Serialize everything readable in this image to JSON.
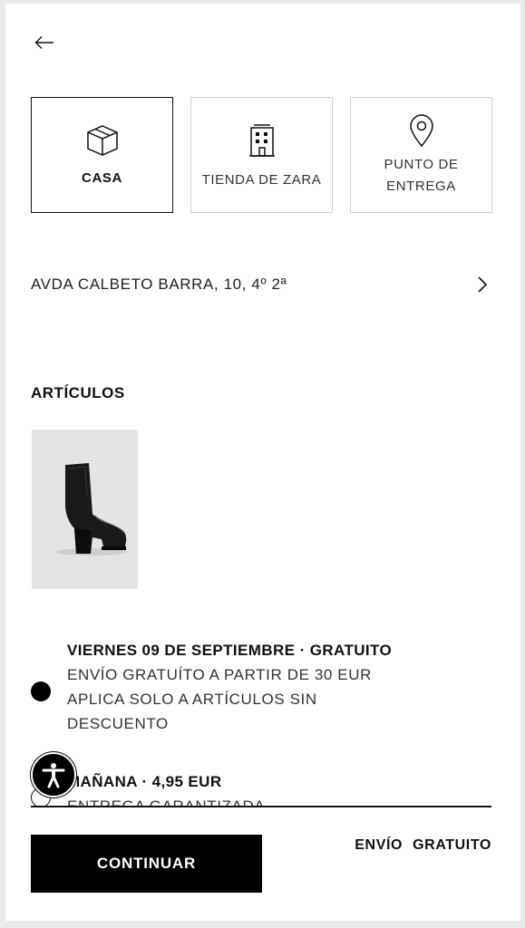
{
  "delivery_methods": [
    {
      "label": "CASA",
      "icon": "box-icon",
      "selected": true
    },
    {
      "label": "TIENDA DE ZARA",
      "icon": "store-building-icon",
      "selected": false
    },
    {
      "label_line1": "PUNTO DE",
      "label_line2": "ENTREGA",
      "icon": "map-pin-icon",
      "selected": false
    }
  ],
  "address": {
    "text": "AVDA CALBETO BARRA, 10, 4º 2ª"
  },
  "items": {
    "title": "ARTÍCULOS",
    "products": [
      {
        "name": "black-heeled-ankle-boot"
      }
    ]
  },
  "shipping_options": [
    {
      "title": "VIERNES 09 DE SEPTIEMBRE · GRATUITO",
      "desc_line1": "ENVÍO GRATUÍTO A PARTIR DE 30 EUR",
      "desc_line2": "APLICA SOLO A ARTÍCULOS SIN",
      "desc_line3": "DESCUENTO",
      "selected": true
    },
    {
      "title": "MAÑANA · 4,95 EUR",
      "desc_line1": "ENTREGA GARANTIZADA",
      "selected": false
    }
  ],
  "footer": {
    "continue_label": "CONTINUAR",
    "shipping_summary": "ENVÍO GRATUITO"
  },
  "colors": {
    "primary": "#000000",
    "border_light": "#cfcfcf",
    "background": "#ffffff"
  }
}
